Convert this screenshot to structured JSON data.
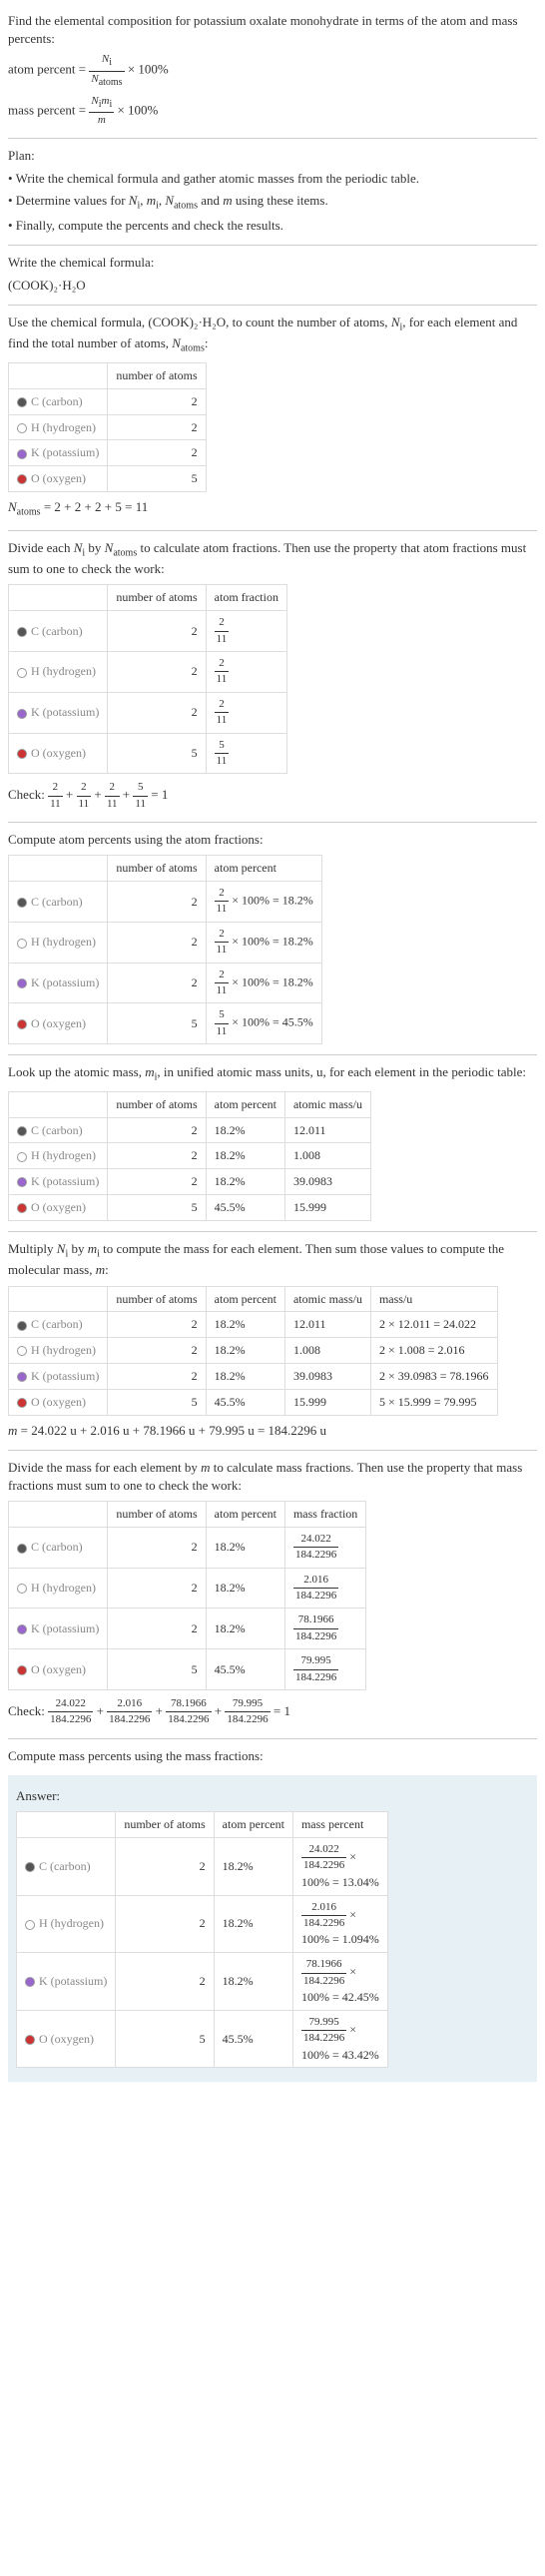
{
  "intro": {
    "line1": "Find the elemental composition for potassium oxalate monohydrate in terms of the atom and mass percents:",
    "atom_percent_label": "atom percent",
    "mass_percent_label": "mass percent",
    "eq": " = ",
    "times100": " × 100%",
    "Ni": "N",
    "Ni_sub": "i",
    "Natoms": "N",
    "Natoms_sub": "atoms",
    "Nimi_num1": "N",
    "Nimi_sub1": "i",
    "Nimi_num2": "m",
    "Nimi_sub2": "i",
    "m": "m"
  },
  "plan": {
    "header": "Plan:",
    "b1": "• Write the chemical formula and gather atomic masses from the periodic table.",
    "b2_pre": "• Determine values for ",
    "b2_N": "N",
    "b2_Nsub": "i",
    "b2_m": "m",
    "b2_msub": "i",
    "b2_Na": "N",
    "b2_Nasub": "atoms",
    "b2_and": " and ",
    "b2_mm": "m",
    "b2_post": " using these items.",
    "b3": "• Finally, compute the percents and check the results.",
    "comma": ", "
  },
  "formula": {
    "label": "Write the chemical formula:",
    "text": "(COOK)₂·H₂O"
  },
  "count": {
    "intro_pre": "Use the chemical formula, (COOK)₂·H₂O, to count the number of atoms, ",
    "Ni": "N",
    "Ni_sub": "i",
    "intro_mid": ", for each element and find the total number of atoms, ",
    "Na": "N",
    "Na_sub": "atoms",
    "intro_post": ":",
    "col_number": "number of atoms",
    "elems": [
      {
        "dot": "dot-c",
        "name": "C (carbon)",
        "n": "2"
      },
      {
        "dot": "dot-h",
        "name": "H (hydrogen)",
        "n": "2"
      },
      {
        "dot": "dot-k",
        "name": "K (potassium)",
        "n": "2"
      },
      {
        "dot": "dot-o",
        "name": "O (oxygen)",
        "n": "5"
      }
    ],
    "total_pre": "N",
    "total_sub": "atoms",
    "total_eq": " = 2 + 2 + 2 + 5 = 11"
  },
  "atomfrac": {
    "intro_pre": "Divide each ",
    "Ni": "N",
    "Ni_sub": "i",
    "intro_mid": " by ",
    "Na": "N",
    "Na_sub": "atoms",
    "intro_post": " to calculate atom fractions. Then use the property that atom fractions must sum to one to check the work:",
    "col_number": "number of atoms",
    "col_frac": "atom fraction",
    "rows": [
      {
        "dot": "dot-c",
        "name": "C (carbon)",
        "n": "2",
        "num": "2",
        "den": "11"
      },
      {
        "dot": "dot-h",
        "name": "H (hydrogen)",
        "n": "2",
        "num": "2",
        "den": "11"
      },
      {
        "dot": "dot-k",
        "name": "K (potassium)",
        "n": "2",
        "num": "2",
        "den": "11"
      },
      {
        "dot": "dot-o",
        "name": "O (oxygen)",
        "n": "5",
        "num": "5",
        "den": "11"
      }
    ],
    "check_label": "Check: ",
    "check_eq": " = 1",
    "plus": " + "
  },
  "atompct": {
    "intro": "Compute atom percents using the atom fractions:",
    "col_number": "number of atoms",
    "col_pct": "atom percent",
    "rows": [
      {
        "dot": "dot-c",
        "name": "C (carbon)",
        "n": "2",
        "num": "2",
        "den": "11",
        "pct": " × 100% = 18.2%"
      },
      {
        "dot": "dot-h",
        "name": "H (hydrogen)",
        "n": "2",
        "num": "2",
        "den": "11",
        "pct": " × 100% = 18.2%"
      },
      {
        "dot": "dot-k",
        "name": "K (potassium)",
        "n": "2",
        "num": "2",
        "den": "11",
        "pct": " × 100% = 18.2%"
      },
      {
        "dot": "dot-o",
        "name": "O (oxygen)",
        "n": "5",
        "num": "5",
        "den": "11",
        "pct": " × 100% = 45.5%"
      }
    ]
  },
  "atomicmass": {
    "intro_pre": "Look up the atomic mass, ",
    "mi": "m",
    "mi_sub": "i",
    "intro_post": ", in unified atomic mass units, u, for each element in the periodic table:",
    "col_number": "number of atoms",
    "col_pct": "atom percent",
    "col_mass": "atomic mass/u",
    "rows": [
      {
        "dot": "dot-c",
        "name": "C (carbon)",
        "n": "2",
        "pct": "18.2%",
        "mass": "12.011"
      },
      {
        "dot": "dot-h",
        "name": "H (hydrogen)",
        "n": "2",
        "pct": "18.2%",
        "mass": "1.008"
      },
      {
        "dot": "dot-k",
        "name": "K (potassium)",
        "n": "2",
        "pct": "18.2%",
        "mass": "39.0983"
      },
      {
        "dot": "dot-o",
        "name": "O (oxygen)",
        "n": "5",
        "pct": "45.5%",
        "mass": "15.999"
      }
    ]
  },
  "molmass": {
    "intro_pre": "Multiply ",
    "Ni": "N",
    "Ni_sub": "i",
    "intro_mid": " by ",
    "mi": "m",
    "mi_sub": "i",
    "intro_post": " to compute the mass for each element. Then sum those values to compute the molecular mass, ",
    "m": "m",
    "intro_colon": ":",
    "col_number": "number of atoms",
    "col_pct": "atom percent",
    "col_amass": "atomic mass/u",
    "col_mass": "mass/u",
    "rows": [
      {
        "dot": "dot-c",
        "name": "C (carbon)",
        "n": "2",
        "pct": "18.2%",
        "amass": "12.011",
        "mass": "2 × 12.011 = 24.022"
      },
      {
        "dot": "dot-h",
        "name": "H (hydrogen)",
        "n": "2",
        "pct": "18.2%",
        "amass": "1.008",
        "mass": "2 × 1.008 = 2.016"
      },
      {
        "dot": "dot-k",
        "name": "K (potassium)",
        "n": "2",
        "pct": "18.2%",
        "amass": "39.0983",
        "mass": "2 × 39.0983 = 78.1966"
      },
      {
        "dot": "dot-o",
        "name": "O (oxygen)",
        "n": "5",
        "pct": "45.5%",
        "amass": "15.999",
        "mass": "5 × 15.999 = 79.995"
      }
    ],
    "total_pre": "m",
    "total_eq": " = 24.022 u + 2.016 u + 78.1966 u + 79.995 u = 184.2296 u"
  },
  "massfrac": {
    "intro_pre": "Divide the mass for each element by ",
    "m": "m",
    "intro_post": " to calculate mass fractions. Then use the property that mass fractions must sum to one to check the work:",
    "col_number": "number of atoms",
    "col_pct": "atom percent",
    "col_frac": "mass fraction",
    "rows": [
      {
        "dot": "dot-c",
        "name": "C (carbon)",
        "n": "2",
        "pct": "18.2%",
        "num": "24.022",
        "den": "184.2296"
      },
      {
        "dot": "dot-h",
        "name": "H (hydrogen)",
        "n": "2",
        "pct": "18.2%",
        "num": "2.016",
        "den": "184.2296"
      },
      {
        "dot": "dot-k",
        "name": "K (potassium)",
        "n": "2",
        "pct": "18.2%",
        "num": "78.1966",
        "den": "184.2296"
      },
      {
        "dot": "dot-o",
        "name": "O (oxygen)",
        "n": "5",
        "pct": "45.5%",
        "num": "79.995",
        "den": "184.2296"
      }
    ],
    "check_label": "Check: ",
    "check_eq": " = 1",
    "plus": " + "
  },
  "masspct": {
    "intro": "Compute mass percents using the mass fractions:"
  },
  "answer": {
    "label": "Answer:",
    "col_number": "number of atoms",
    "col_apct": "atom percent",
    "col_mpct": "mass percent",
    "rows": [
      {
        "dot": "dot-c",
        "name": "C (carbon)",
        "n": "2",
        "apct": "18.2%",
        "num": "24.022",
        "den": "184.2296",
        "res": "100% = 13.04%"
      },
      {
        "dot": "dot-h",
        "name": "H (hydrogen)",
        "n": "2",
        "apct": "18.2%",
        "num": "2.016",
        "den": "184.2296",
        "res": "100% = 1.094%"
      },
      {
        "dot": "dot-k",
        "name": "K (potassium)",
        "n": "2",
        "apct": "18.2%",
        "num": "78.1966",
        "den": "184.2296",
        "res": "100% = 42.45%"
      },
      {
        "dot": "dot-o",
        "name": "O (oxygen)",
        "n": "5",
        "apct": "45.5%",
        "num": "79.995",
        "den": "184.2296",
        "res": "100% = 43.42%"
      }
    ],
    "times": " × "
  }
}
